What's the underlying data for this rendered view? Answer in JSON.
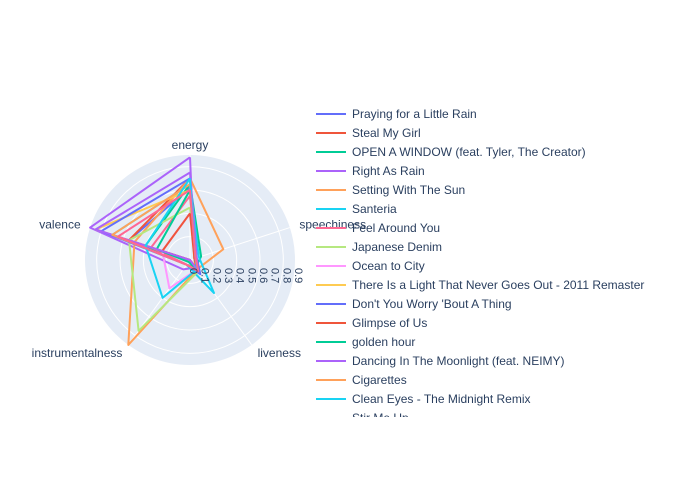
{
  "chart_data": {
    "type": "radar",
    "axes": [
      "energy",
      "speechiness",
      "liveness",
      "instrumentalness",
      "valence"
    ],
    "radial_ticks": [
      "0",
      "0.1",
      "0.2",
      "0.3",
      "0.4",
      "0.5",
      "0.6",
      "0.7",
      "0.8",
      "0.9"
    ],
    "rmax": 0.9,
    "legend_position": "right",
    "series": [
      {
        "name": "Praying for a Little Rain",
        "color": "#636efa",
        "values": [
          0.62,
          0.04,
          0.1,
          0.05,
          0.55
        ]
      },
      {
        "name": "Steal My Girl",
        "color": "#EF553B",
        "values": [
          0.7,
          0.04,
          0.12,
          0.0,
          0.55
        ]
      },
      {
        "name": "OPEN A WINDOW (feat. Tyler, The Creator)",
        "color": "#00cc96",
        "values": [
          0.65,
          0.1,
          0.08,
          0.05,
          0.4
        ]
      },
      {
        "name": "Right As Rain",
        "color": "#ab63fa",
        "values": [
          0.88,
          0.04,
          0.08,
          0.1,
          0.9
        ]
      },
      {
        "name": "Setting With The Sun",
        "color": "#FFA15A",
        "values": [
          0.7,
          0.3,
          0.1,
          0.9,
          0.5
        ]
      },
      {
        "name": "Santeria",
        "color": "#19d3f3",
        "values": [
          0.65,
          0.08,
          0.35,
          0.05,
          0.7
        ]
      },
      {
        "name": "Feel Around You",
        "color": "#FF6692",
        "values": [
          0.55,
          0.05,
          0.1,
          0.05,
          0.35
        ]
      },
      {
        "name": "Japanese Denim",
        "color": "#B6E880",
        "values": [
          0.45,
          0.05,
          0.12,
          0.75,
          0.55
        ]
      },
      {
        "name": "Ocean to City",
        "color": "#FF97FF",
        "values": [
          0.4,
          0.05,
          0.1,
          0.3,
          0.25
        ]
      },
      {
        "name": "There Is a Light That Never Goes Out - 2011 Remaster",
        "color": "#FECB52",
        "values": [
          0.6,
          0.04,
          0.08,
          0.0,
          0.85
        ]
      },
      {
        "name": "Don't You Worry 'Bout A Thing",
        "color": "#636efa",
        "values": [
          0.7,
          0.06,
          0.15,
          0.05,
          0.8
        ]
      },
      {
        "name": "Glimpse of Us",
        "color": "#EF553B",
        "values": [
          0.4,
          0.04,
          0.1,
          0.0,
          0.25
        ]
      },
      {
        "name": "golden hour",
        "color": "#00cc96",
        "values": [
          0.6,
          0.05,
          0.1,
          0.02,
          0.3
        ]
      },
      {
        "name": "Dancing In The Moonlight (feat. NEIMY)",
        "color": "#ab63fa",
        "values": [
          0.75,
          0.06,
          0.12,
          0.0,
          0.85
        ]
      },
      {
        "name": "Cigarettes",
        "color": "#FFA15A",
        "values": [
          0.65,
          0.05,
          0.12,
          0.05,
          0.7
        ]
      },
      {
        "name": "Clean Eyes - The Midnight Remix",
        "color": "#19d3f3",
        "values": [
          0.7,
          0.05,
          0.1,
          0.4,
          0.4
        ]
      },
      {
        "name": "Stir Me Up",
        "color": "#FF6692",
        "values": [
          0.6,
          0.05,
          0.12,
          0.05,
          0.65
        ]
      }
    ]
  }
}
